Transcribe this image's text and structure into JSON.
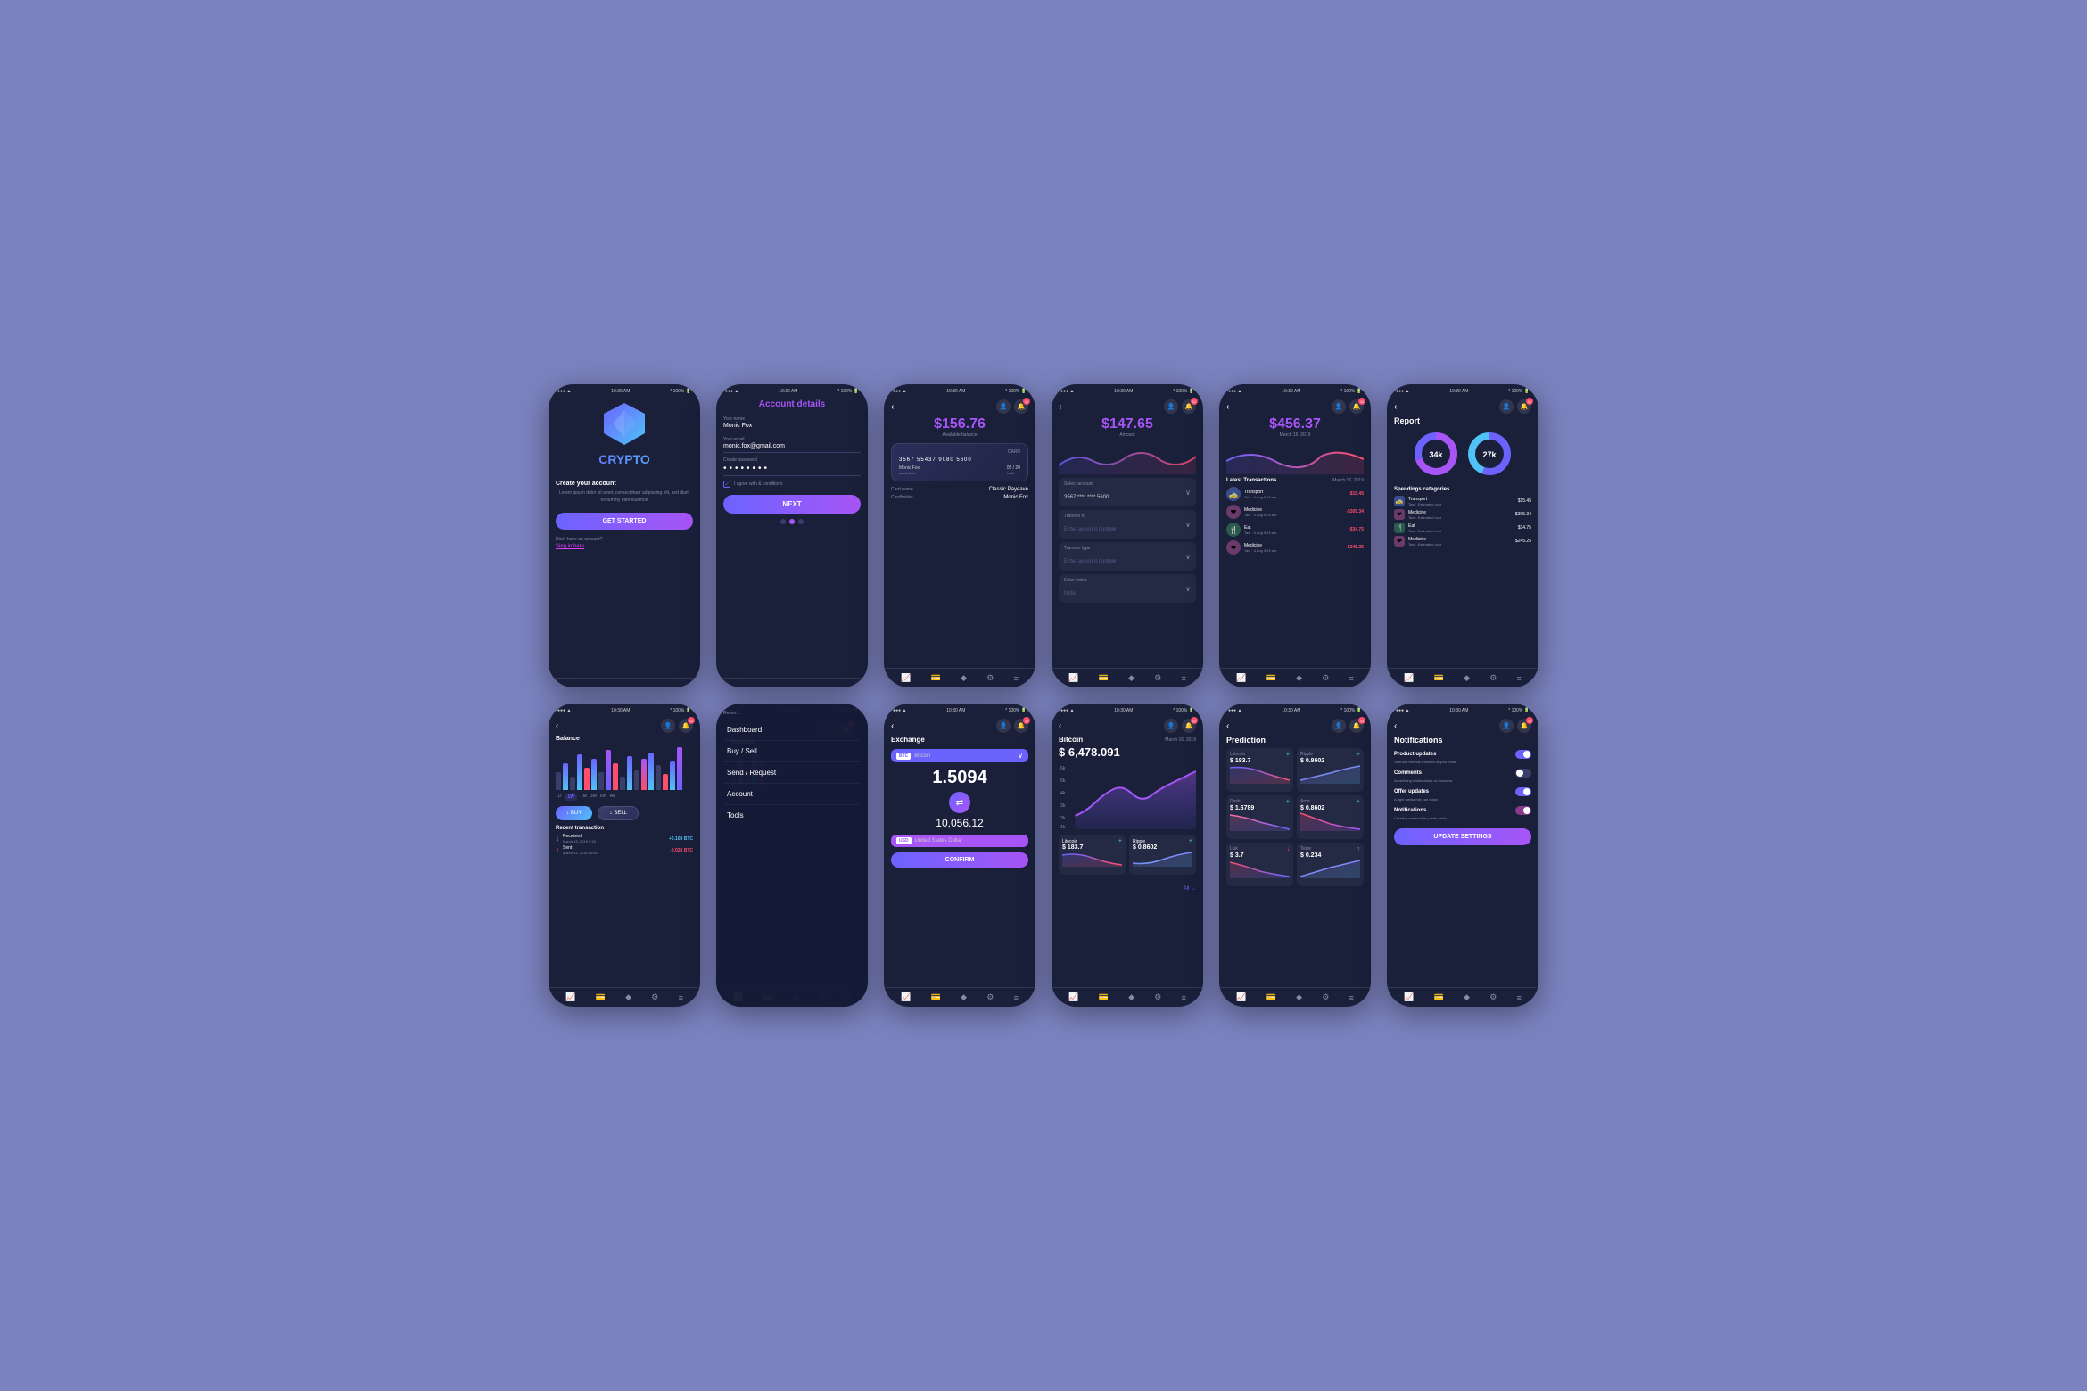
{
  "app": {
    "name": "CRYPTO",
    "tagline": "Create your account",
    "description": "Lorem ipsum dolor sit amet, consectetuer adipiscing elit, sed diam nonummy nibh euismod"
  },
  "buttons": {
    "get_started": "GET STARTED",
    "next": "NEXT",
    "buy": "BUY",
    "sell": "SELL",
    "confirm": "CONFIRM",
    "update_settings": "UPDATE SETTINGS",
    "all": "All"
  },
  "links": {
    "dont_have": "Don't have an account?",
    "sign_in": "Sing in here"
  },
  "account_details": {
    "title": "Account details",
    "name_label": "Your name",
    "name_value": "Monic Fox",
    "email_label": "Your email",
    "email_value": "monic.fox@gmail.com",
    "password_label": "Create password",
    "password_value": "••••••••",
    "agree_text": "I agree with & conditions"
  },
  "card_screen": {
    "balance": "$156.76",
    "balance_label": "Available balance",
    "card_number": "3567 55437 9080 5600",
    "cardholder": "Monic Fox",
    "expiry": "05 / 20",
    "valid": "valid",
    "card_label": "CARD",
    "card_name_label": "Card name",
    "card_name_value": "Classic Payeave",
    "cardholder_label": "Cardholder",
    "cardholder_value": "Monic Fox"
  },
  "transfer_screen": {
    "amount": "$147.65",
    "amount_label": "Amount",
    "select_account_label": "Select account",
    "select_account_value": "3567 **** **** 5600",
    "transfer_to_label": "Transfer to",
    "transfer_to_placeholder": "Enter account number",
    "transfer_type_label": "Transfer type",
    "transfer_type_placeholder": "Enter account number",
    "notes_label": "Enter notes",
    "notes_placeholder": "Note"
  },
  "transactions_screen": {
    "amount": "$456.37",
    "date": "March 16, 2019",
    "section_title": "Latest Transactions",
    "section_date": "March 16, 2019",
    "items": [
      {
        "category": "Transport",
        "sub": "Taxi",
        "date": "4 Aug  9:15 am",
        "amount": "-$15.45",
        "icon": "🚕",
        "color": "#3a4f8a"
      },
      {
        "category": "Medicine",
        "sub": "Taxi",
        "date": "4 Aug  9:15 am",
        "amount": "-$305.34",
        "icon": "❤️",
        "color": "#8a3a6a"
      },
      {
        "category": "Eat",
        "sub": "Taxi",
        "date": "4 Aug  9:15 am",
        "amount": "-$34.75",
        "icon": "🍴",
        "color": "#3a6a4a"
      },
      {
        "category": "Medicine",
        "sub": "Taxi",
        "date": "4 Aug  9:15 am",
        "amount": "-$245.25",
        "icon": "❤️",
        "color": "#8a3a6a"
      }
    ]
  },
  "report_screen": {
    "title": "Report",
    "donut1_value": "34k",
    "donut2_value": "27k",
    "spending_title": "Spendings categories",
    "items": [
      {
        "name": "Transport",
        "sub": "Taxi - Estimated cost",
        "amount": "$15.45",
        "icon": "🚕",
        "color": "#3a4f8a"
      },
      {
        "name": "Medicine",
        "sub": "Taxi - Estimated cost",
        "amount": "$305.34",
        "icon": "❤️",
        "color": "#8a3a6a"
      },
      {
        "name": "Eat",
        "sub": "Taxi - Estimated cost",
        "amount": "$34.75",
        "icon": "🍴",
        "color": "#3a6a4a"
      },
      {
        "name": "Medicine",
        "sub": "Taxi - Estimated cost",
        "amount": "$245.25",
        "icon": "❤️",
        "color": "#8a3a6a"
      }
    ]
  },
  "balance_screen": {
    "title": "Balance",
    "time_tabs": [
      "1D",
      "1W",
      "1M",
      "3M",
      "6M",
      "All"
    ],
    "active_tab": "1W",
    "recent_label": "Recent transaction",
    "transactions": [
      {
        "type": "Received",
        "date": "March 15, 2019 9:15",
        "amount": "+0.108 BTC",
        "positive": true
      },
      {
        "type": "Sent",
        "date": "March 11, 2019 10:45",
        "amount": "-0.028 BTC",
        "positive": false
      }
    ]
  },
  "menu_items": [
    "Dashboard",
    "Buy / Sell",
    "Send / Request",
    "Account",
    "Tools"
  ],
  "exchange_screen": {
    "title": "Exchange",
    "crypto": "Bitcoin",
    "crypto_code": "BTC",
    "value": "1.5094",
    "usd_value": "10,056.12",
    "fiat": "United States Dollar",
    "fiat_code": "USD"
  },
  "bitcoin_screen": {
    "title": "Bitcoin",
    "date": "March 16, 2019",
    "price": "$ 6,478.091",
    "cryptos": [
      {
        "name": "Litecoin",
        "price": "$ 183.7",
        "trend": "down"
      },
      {
        "name": "Ripple",
        "price": "$ 0.8602",
        "trend": "up"
      },
      {
        "name": "All"
      }
    ]
  },
  "prediction_screen": {
    "title": "Prediction",
    "cryptos": [
      {
        "name": "Litecoin",
        "price": "$ 183.7",
        "trend": "down"
      },
      {
        "name": "Ripple",
        "price": "$ 0.8602",
        "trend": "up"
      },
      {
        "name": "Dash",
        "price": "$ 1.6789",
        "trend": "down"
      },
      {
        "name": "Ardo",
        "price": "$ 0.8602",
        "trend": "down"
      },
      {
        "name": "Lisk",
        "price": "$ 3.7",
        "trend": "down"
      },
      {
        "name": "Tezor",
        "price": "$ 0.234",
        "trend": "up"
      }
    ]
  },
  "notifications_screen": {
    "title": "Notifications",
    "items": [
      {
        "name": "Product updates",
        "sub": "Stair lifts free the freedom of your home",
        "enabled": true
      },
      {
        "name": "Comments",
        "sub": "Advertising relationships vs business",
        "enabled": false
      },
      {
        "name": "Offer updates",
        "sub": "A right media mix can make",
        "enabled": true
      },
      {
        "name": "Notifications",
        "sub": "Creating remarkable poster prints",
        "enabled": false
      }
    ]
  },
  "status_bar": {
    "time": "10:30 AM",
    "battery": "100%",
    "signal": "●●●"
  },
  "colors": {
    "accent_purple": "#a855f7",
    "accent_blue": "#6c63ff",
    "positive": "#4fc3f7",
    "negative": "#ff4d6d",
    "bg_dark": "#1a1f3a",
    "bg_card": "#2a2f5a"
  }
}
